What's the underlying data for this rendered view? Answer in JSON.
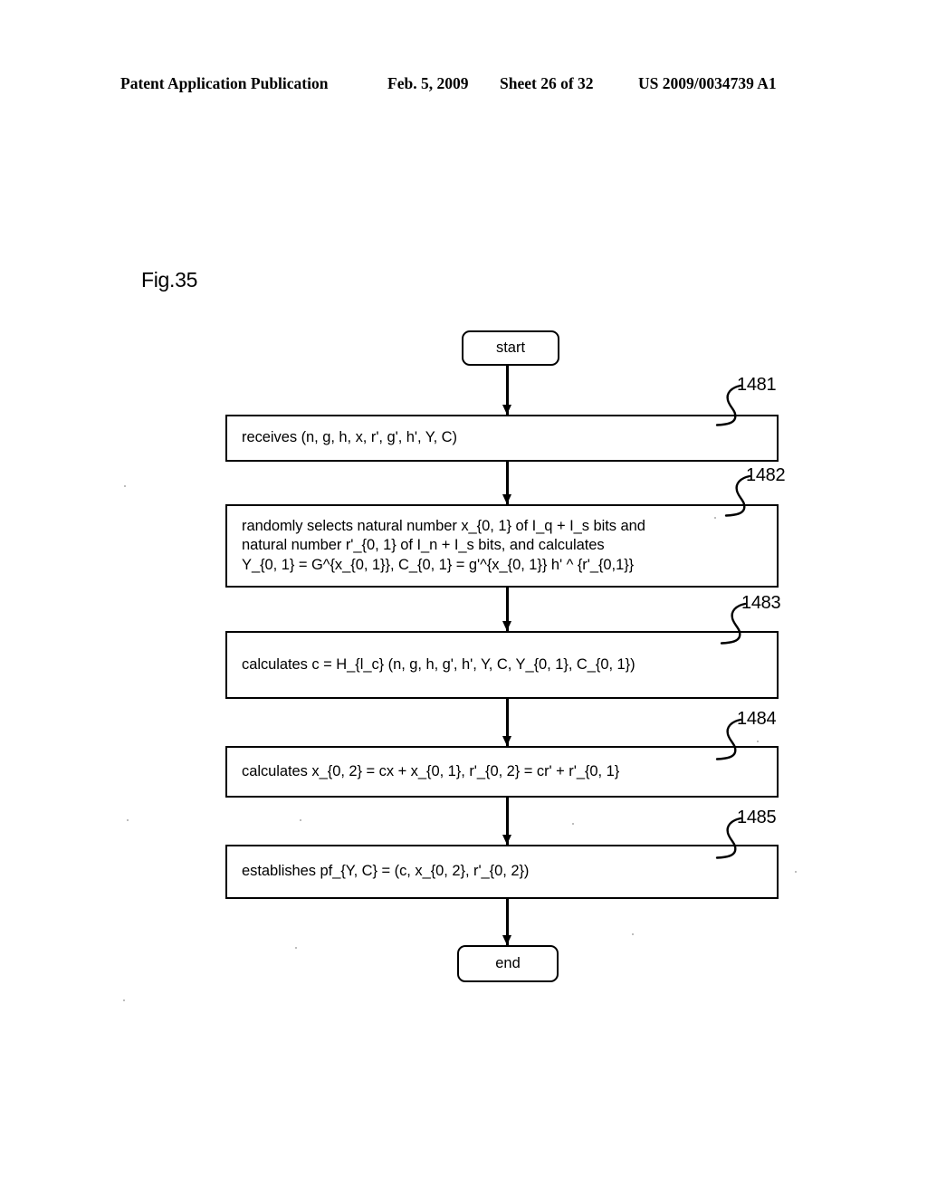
{
  "header": {
    "publication": "Patent Application Publication",
    "date": "Feb. 5, 2009",
    "sheet": "Sheet 26 of 32",
    "patent_number": "US 2009/0034739 A1"
  },
  "figure": {
    "label": "Fig.35"
  },
  "flowchart": {
    "start_label": "start",
    "end_label": "end",
    "steps": [
      {
        "ref": "1481",
        "text": "receives (n, g, h, x, r', g', h', Y, C)"
      },
      {
        "ref": "1482",
        "text": "randomly selects natural number x_{0, 1} of I_q + I_s bits and\nnatural number r'_{0, 1} of I_n + I_s bits, and calculates\nY_{0, 1} = G^{x_{0, 1}}, C_{0, 1} = g'^{x_{0, 1}} h' ^ {r'_{0,1}}"
      },
      {
        "ref": "1483",
        "text": "calculates c = H_{l_c} (n, g, h, g', h', Y, C, Y_{0, 1}, C_{0, 1})"
      },
      {
        "ref": "1484",
        "text": "calculates x_{0, 2} = cx + x_{0, 1}, r'_{0, 2} = cr' + r'_{0, 1}"
      },
      {
        "ref": "1485",
        "text": "establishes pf_{Y, C} = (c, x_{0, 2}, r'_{0, 2})"
      }
    ]
  },
  "colors": {
    "ink": "#000000",
    "paper": "#ffffff"
  }
}
